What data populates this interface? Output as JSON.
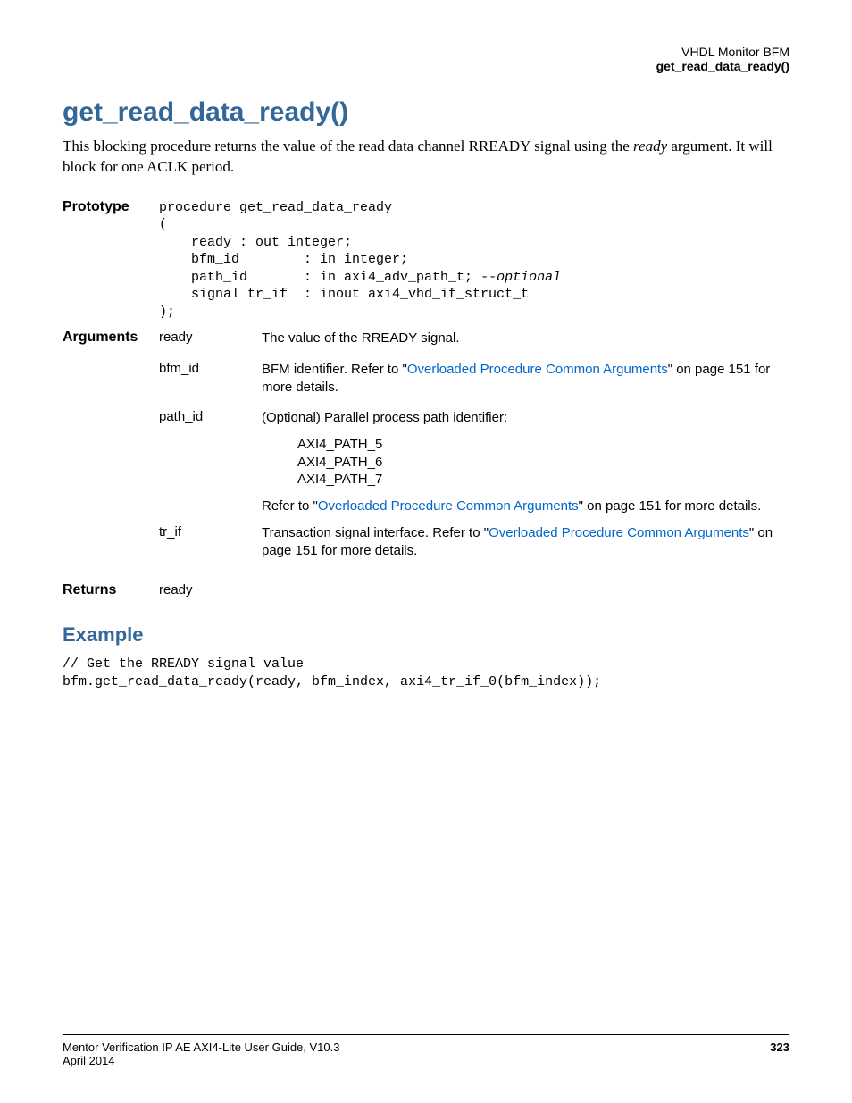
{
  "header": {
    "line1": "VHDL Monitor BFM",
    "line2": "get_read_data_ready()"
  },
  "title": "get_read_data_ready()",
  "intro": {
    "part1": "This blocking procedure returns the value of the read data channel RREADY signal using the ",
    "arg": "ready",
    "part2": " argument. It will block for one ACLK period."
  },
  "prototype": {
    "label": "Prototype",
    "line1": "procedure get_read_data_ready",
    "line2": "(",
    "line3": "    ready : out integer;",
    "line4": "    bfm_id        : in integer;",
    "line5a": "    path_id       : in axi4_adv_path_t; ",
    "line5b": "--optional",
    "line6": "    signal tr_if  : inout axi4_vhd_if_struct_t",
    "line7": ");"
  },
  "arguments": {
    "label": "Arguments",
    "rows": {
      "ready": {
        "name": "ready",
        "desc": "The value of the RREADY signal."
      },
      "bfm_id": {
        "name": "bfm_id",
        "pre": "BFM identifier. Refer to \"",
        "link": "Overloaded Procedure Common Arguments",
        "post": "\" on page 151 for more details."
      },
      "path_id": {
        "name": "path_id",
        "desc1": "(Optional) Parallel process path identifier:",
        "paths": {
          "p5": "AXI4_PATH_5",
          "p6": "AXI4_PATH_6",
          "p7": "AXI4_PATH_7"
        },
        "post_pre": "Refer to \"",
        "post_link": "Overloaded Procedure Common Arguments",
        "post_post": "\" on page 151 for more details."
      },
      "tr_if": {
        "name": "tr_if",
        "pre": "Transaction signal interface. Refer to \"",
        "link": "Overloaded Procedure Common Arguments",
        "post": "\" on page 151 for more details."
      }
    }
  },
  "returns": {
    "label": "Returns",
    "value": "ready"
  },
  "example": {
    "heading": "Example",
    "line1": "// Get the RREADY signal value",
    "line2": "bfm.get_read_data_ready(ready, bfm_index, axi4_tr_if_0(bfm_index));"
  },
  "footer": {
    "left": "Mentor Verification IP AE AXI4-Lite User Guide, V10.3",
    "date": "April 2014",
    "page": "323"
  }
}
